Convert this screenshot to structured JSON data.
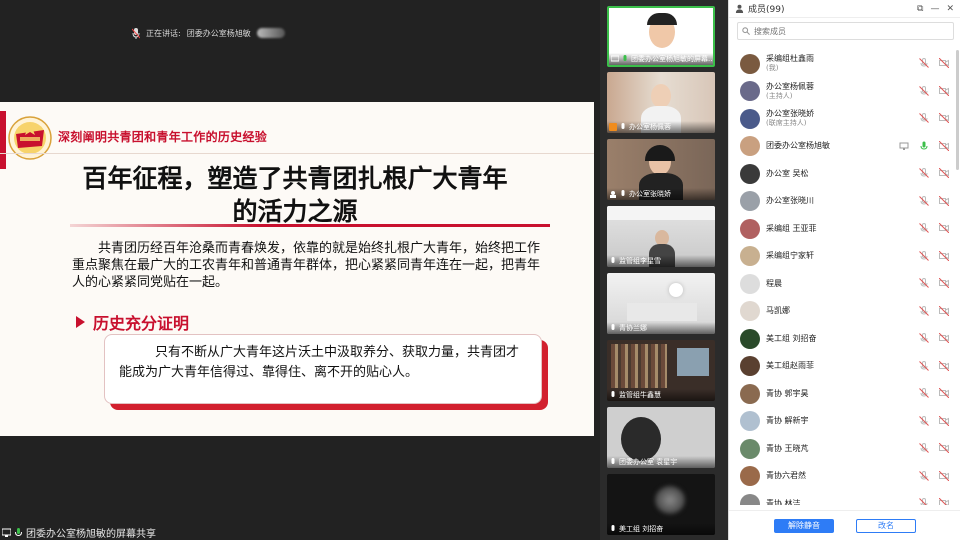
{
  "speaking": {
    "prefix": "正在讲话:",
    "name": "团委办公室杨旭敏"
  },
  "slide": {
    "section_title": "深刻阐明共青团和青年工作的历史经验",
    "main_title_line1": "百年征程，塑造了共青团扎根广大青年",
    "main_title_line2": "的活力之源",
    "body": "共青团历经百年沧桑而青春焕发，依靠的就是始终扎根广大青年，始终把工作重点聚焦在最广大的工农青年和普通青年群体，把心紧紧同青年连在一起，把青年人的心紧紧同党贴在一起。",
    "sub_heading": "历史充分证明",
    "quote": "只有不断从广大青年这片沃土中汲取养分、获取力量，共青团才能成为广大青年信得过、靠得住、离不开的贴心人。",
    "accent": "#c8102e"
  },
  "share_footer": "团委办公室杨旭敏的屏幕共享",
  "tiles": [
    {
      "label": "团委办公室杨旭敏的屏幕..."
    },
    {
      "label": "办公室杨佩蓉"
    },
    {
      "label": "办公室张晓娇"
    },
    {
      "label": "监管组李星雪"
    },
    {
      "label": "青协兰娜"
    },
    {
      "label": "监管组牛鑫慧"
    },
    {
      "label": "团委办公室 袁星宇"
    },
    {
      "label": "美工组 刘招奋"
    }
  ],
  "panel": {
    "title": "成员(99)",
    "search_placeholder": "搜索成员",
    "members": [
      {
        "name": "采编组杜鑫雨",
        "role": "(我)"
      },
      {
        "name": "办公室杨佩蓉",
        "role": "(主持人)"
      },
      {
        "name": "办公室张晓娇",
        "role": "(联席主持人)"
      },
      {
        "name": "团委办公室杨旭敏",
        "role": ""
      },
      {
        "name": "办公室 吴松",
        "role": ""
      },
      {
        "name": "办公室张晓川",
        "role": ""
      },
      {
        "name": "采编组 王亚菲",
        "role": ""
      },
      {
        "name": "采编组宁家轩",
        "role": ""
      },
      {
        "name": "程晨",
        "role": ""
      },
      {
        "name": "马凯娜",
        "role": ""
      },
      {
        "name": "美工组 刘招奋",
        "role": ""
      },
      {
        "name": "美工组赵雨菲",
        "role": ""
      },
      {
        "name": "青协 郭宇昊",
        "role": ""
      },
      {
        "name": "青协 解新宇",
        "role": ""
      },
      {
        "name": "青协 王晓芃",
        "role": ""
      },
      {
        "name": "青协六君然",
        "role": ""
      },
      {
        "name": "青协 林洁",
        "role": ""
      }
    ],
    "unmute_all": "解除静音",
    "rename": "改名"
  }
}
